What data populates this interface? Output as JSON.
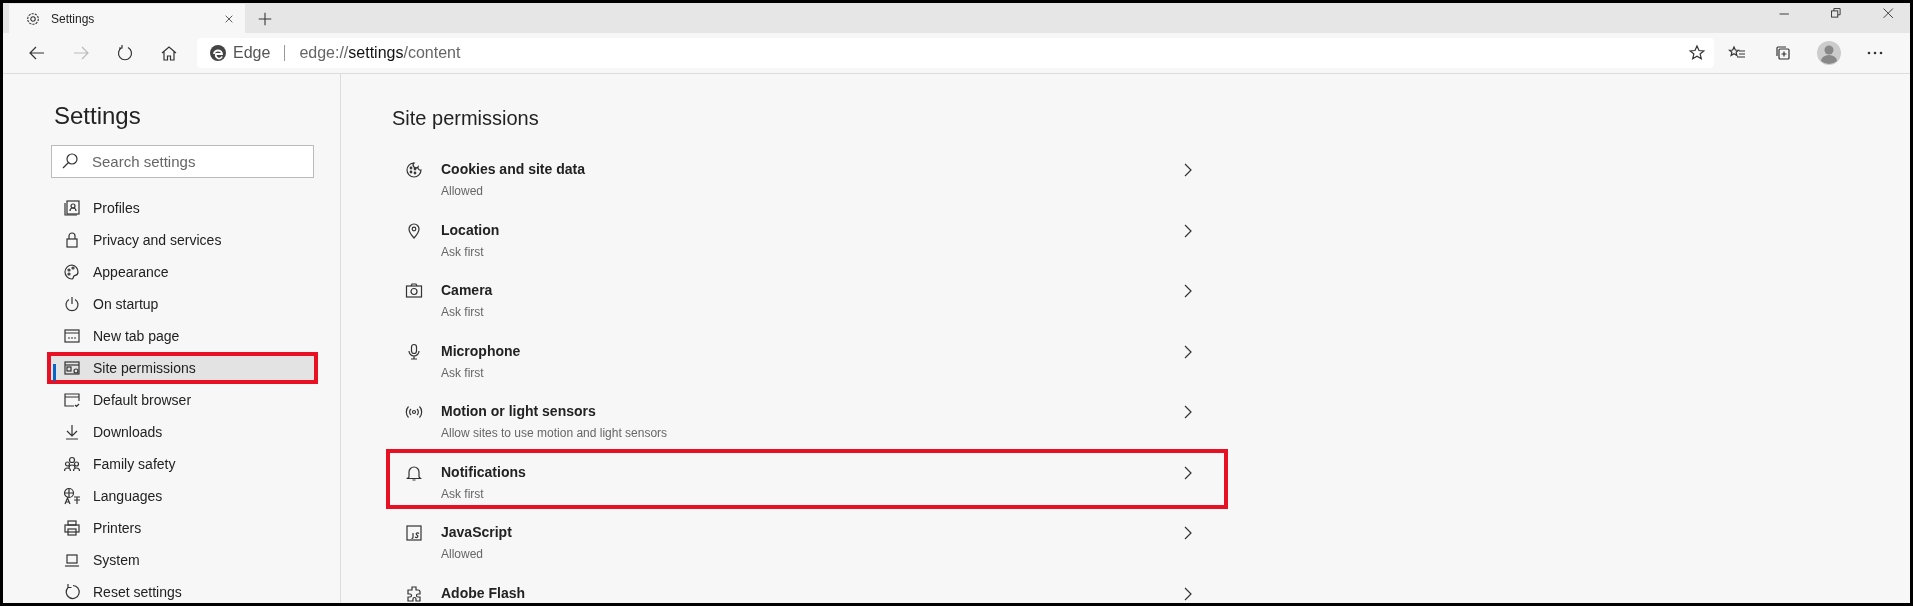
{
  "tab": {
    "title": "Settings"
  },
  "address": {
    "site_label": "Edge",
    "scheme": "edge://",
    "host": "settings",
    "path": "/content"
  },
  "sidebar": {
    "title": "Settings",
    "search": {
      "placeholder": "Search settings"
    },
    "items": [
      {
        "label": "Profiles",
        "selected": false,
        "highlighted": false
      },
      {
        "label": "Privacy and services",
        "selected": false,
        "highlighted": false
      },
      {
        "label": "Appearance",
        "selected": false,
        "highlighted": false
      },
      {
        "label": "On startup",
        "selected": false,
        "highlighted": false
      },
      {
        "label": "New tab page",
        "selected": false,
        "highlighted": false
      },
      {
        "label": "Site permissions",
        "selected": true,
        "highlighted": true
      },
      {
        "label": "Default browser",
        "selected": false,
        "highlighted": false
      },
      {
        "label": "Downloads",
        "selected": false,
        "highlighted": false
      },
      {
        "label": "Family safety",
        "selected": false,
        "highlighted": false
      },
      {
        "label": "Languages",
        "selected": false,
        "highlighted": false
      },
      {
        "label": "Printers",
        "selected": false,
        "highlighted": false
      },
      {
        "label": "System",
        "selected": false,
        "highlighted": false
      },
      {
        "label": "Reset settings",
        "selected": false,
        "highlighted": false
      }
    ]
  },
  "content": {
    "title": "Site permissions",
    "permissions": [
      {
        "name": "Cookies and site data",
        "status": "Allowed",
        "highlighted": false
      },
      {
        "name": "Location",
        "status": "Ask first",
        "highlighted": false
      },
      {
        "name": "Camera",
        "status": "Ask first",
        "highlighted": false
      },
      {
        "name": "Microphone",
        "status": "Ask first",
        "highlighted": false
      },
      {
        "name": "Motion or light sensors",
        "status": "Allow sites to use motion and light sensors",
        "highlighted": false
      },
      {
        "name": "Notifications",
        "status": "Ask first",
        "highlighted": true
      },
      {
        "name": "JavaScript",
        "status": "Allowed",
        "highlighted": false
      },
      {
        "name": "Adobe Flash",
        "highlighted": false
      }
    ]
  }
}
